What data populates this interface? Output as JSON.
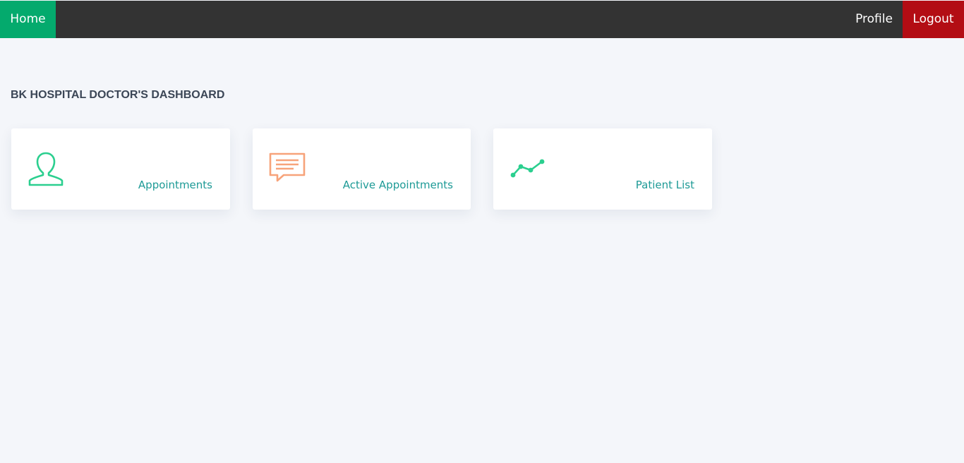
{
  "nav": {
    "home_label": "Home",
    "profile_label": "Profile",
    "logout_label": "Logout"
  },
  "page": {
    "title": "BK HOSPITAL DOCTOR'S DASHBOARD"
  },
  "cards": [
    {
      "label": "Appointments",
      "icon": "user-icon",
      "icon_color": "#2bcf8f"
    },
    {
      "label": "Active Appointments",
      "icon": "chat-bubble-icon",
      "icon_color": "#f7a37a"
    },
    {
      "label": "Patient List",
      "icon": "line-chart-icon",
      "icon_color": "#2bcf8f"
    }
  ],
  "colors": {
    "nav_background": "#333333",
    "home_background": "#04aa6d",
    "logout_background": "#b30d14",
    "page_background": "#f4f6fa",
    "card_label": "#1d9a96",
    "title": "#3b4656"
  }
}
